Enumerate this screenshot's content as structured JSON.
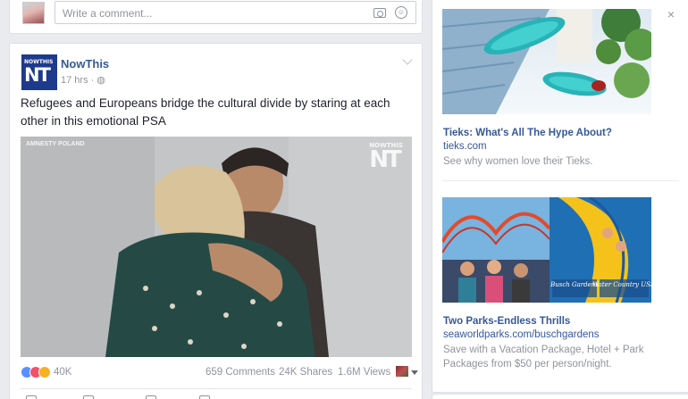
{
  "comment_box": {
    "placeholder": "Write a comment...",
    "camera_icon": "camera-icon",
    "emoji_icon": "smile-icon"
  },
  "post": {
    "page_name": "NowThis",
    "avatar_small": "NOWTHIS",
    "avatar_big": "NT",
    "timestamp": "17 hrs · ",
    "privacy_icon": "globe-icon",
    "text": "Refugees and Europeans bridge the cultural divide by staring at each other in this emotional PSA",
    "video": {
      "watermark_left": "AMNESTY POLAND",
      "watermark_right_small": "NOWTHIS",
      "watermark_right_big": "NT"
    },
    "stats": {
      "reactions": "40K",
      "comments": "659 Comments",
      "shares": "24K Shares",
      "views": "1.6M Views"
    }
  },
  "ads": {
    "close_label": "×",
    "items": [
      {
        "title": "Tieks: What's All The Hype About?",
        "domain": "tieks.com",
        "description": "See why women love their Tieks."
      },
      {
        "title": "Two Parks-Endless Thrills",
        "domain": "seaworldparks.com/buschgardens",
        "description": "Save with a Vacation Package, Hotel + Park Packages from $50 per person/night.",
        "image_text_1": "Busch Gardens",
        "image_text_2": "Water Country USA"
      }
    ]
  },
  "colors": {
    "link_blue": "#365899",
    "muted_gray": "#90949c",
    "page_bg": "#e9ebee",
    "like_blue": "#5890ff",
    "love_red": "#f25268",
    "sad_yellow": "#f7b125"
  }
}
